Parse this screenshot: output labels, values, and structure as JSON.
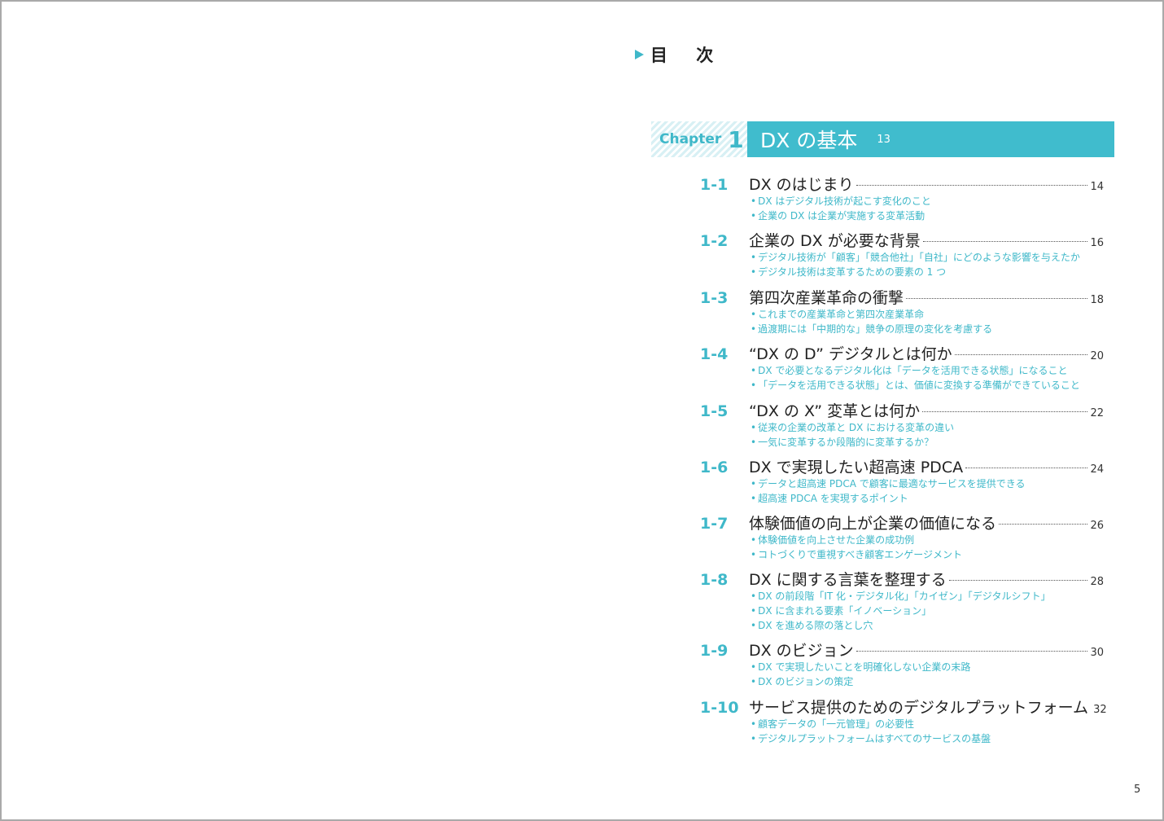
{
  "heading": {
    "label": "目 次"
  },
  "chapter": {
    "word": "Chapter",
    "number": "1",
    "title": "DX の基本",
    "page": "13"
  },
  "entries": [
    {
      "num": "1-1",
      "title": "DX のはじまり",
      "page": "14",
      "subs": [
        "DX はデジタル技術が起こす変化のこと",
        "企業の DX は企業が実施する変革活動"
      ]
    },
    {
      "num": "1-2",
      "title": "企業の DX が必要な背景",
      "page": "16",
      "subs": [
        "デジタル技術が「顧客」「競合他社」「自社」にどのような影響を与えたか",
        "デジタル技術は変革するための要素の 1 つ"
      ]
    },
    {
      "num": "1-3",
      "title": "第四次産業革命の衝撃",
      "page": "18",
      "subs": [
        "これまでの産業革命と第四次産業革命",
        "過渡期には「中期的な」競争の原理の変化を考慮する"
      ]
    },
    {
      "num": "1-4",
      "title": "“DX の D” デジタルとは何か",
      "page": "20",
      "subs": [
        "DX で必要となるデジタル化は「データを活用できる状態」になること",
        "「データを活用できる状態」とは、価値に変換する準備ができていること"
      ]
    },
    {
      "num": "1-5",
      "title": "“DX の X” 変革とは何か",
      "page": "22",
      "subs": [
        "従来の企業の改革と DX における変革の違い",
        "一気に変革するか段階的に変革するか？"
      ]
    },
    {
      "num": "1-6",
      "title": "DX で実現したい超高速 PDCA",
      "page": "24",
      "subs": [
        "データと超高速 PDCA で顧客に最適なサービスを提供できる",
        "超高速 PDCA を実現するポイント"
      ]
    },
    {
      "num": "1-7",
      "title": "体験価値の向上が企業の価値になる",
      "page": "26",
      "subs": [
        "体験価値を向上させた企業の成功例",
        "コトづくりで重視すべき顧客エンゲージメント"
      ]
    },
    {
      "num": "1-8",
      "title": "DX に関する言葉を整理する",
      "page": "28",
      "subs": [
        "DX の前段階「IT 化・デジタル化」「カイゼン」「デジタルシフト」",
        "DX に含まれる要素「イノベーション」",
        "DX を進める際の落とし穴"
      ]
    },
    {
      "num": "1-9",
      "title": "DX のビジョン",
      "page": "30",
      "subs": [
        "DX で実現したいことを明確化しない企業の末路",
        "DX のビジョンの策定"
      ]
    },
    {
      "num": "1-10",
      "title": "サービス提供のためのデジタルプラットフォーム",
      "page": "32",
      "subs": [
        "顧客データの「一元管理」の必要性",
        "デジタルプラットフォームはすべてのサービスの基盤"
      ]
    }
  ],
  "folio": "5",
  "colors": {
    "accent": "#40bccd",
    "text": "#222222",
    "frame": "#a9a9a9"
  }
}
